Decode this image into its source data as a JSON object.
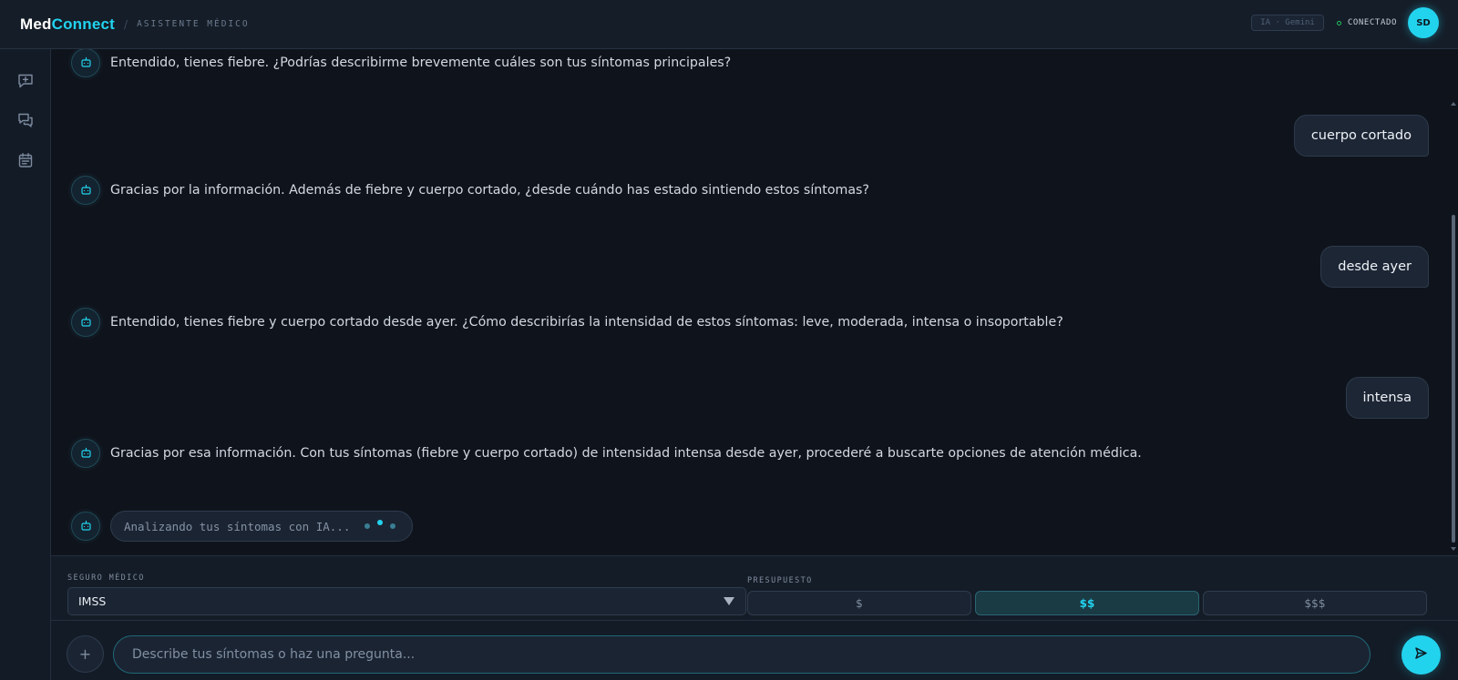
{
  "header": {
    "brand_part1": "Med",
    "brand_part2": "Connect",
    "separator": "/",
    "subtitle": "ASISTENTE MÉDICO",
    "ai_badge": "IA · Gemini",
    "status": "CONECTADO",
    "avatar_initials": "SD"
  },
  "sidebar": {
    "items": [
      {
        "icon": "new-chat-icon"
      },
      {
        "icon": "conversations-icon"
      },
      {
        "icon": "calendar-icon"
      }
    ]
  },
  "chat": {
    "messages": [
      {
        "role": "bot",
        "text": "Entendido, tienes fiebre. ¿Podrías describirme brevemente cuáles son tus síntomas principales?"
      },
      {
        "role": "user",
        "text": "cuerpo cortado"
      },
      {
        "role": "bot",
        "text": "Gracias por la información. Además de fiebre y cuerpo cortado, ¿desde cuándo has estado sintiendo estos síntomas?"
      },
      {
        "role": "user",
        "text": "desde ayer"
      },
      {
        "role": "bot",
        "text": "Entendido, tienes fiebre y cuerpo cortado desde ayer. ¿Cómo describirías la intensidad de estos síntomas: leve, moderada, intensa o insoportable?"
      },
      {
        "role": "user",
        "text": "intensa"
      },
      {
        "role": "bot",
        "text": "Gracias por esa información. Con tus síntomas (fiebre y cuerpo cortado) de intensidad intensa desde ayer, procederé a buscarte opciones de atención médica."
      }
    ],
    "typing_text": "Analizando tus síntomas con IA..."
  },
  "options": {
    "insurance_label": "SEGURO MÉDICO",
    "insurance_value": "IMSS",
    "budget_label": "PRESUPUESTO",
    "budget_options": [
      "$",
      "$$",
      "$$$"
    ],
    "budget_selected": "$$"
  },
  "composer": {
    "add_label": "+",
    "placeholder": "Describe tus síntomas o haz una pregunta..."
  },
  "colors": {
    "accent": "#22d3ee",
    "background": "#0f141c",
    "panel": "#151d28",
    "status_ok": "#22c55e"
  }
}
